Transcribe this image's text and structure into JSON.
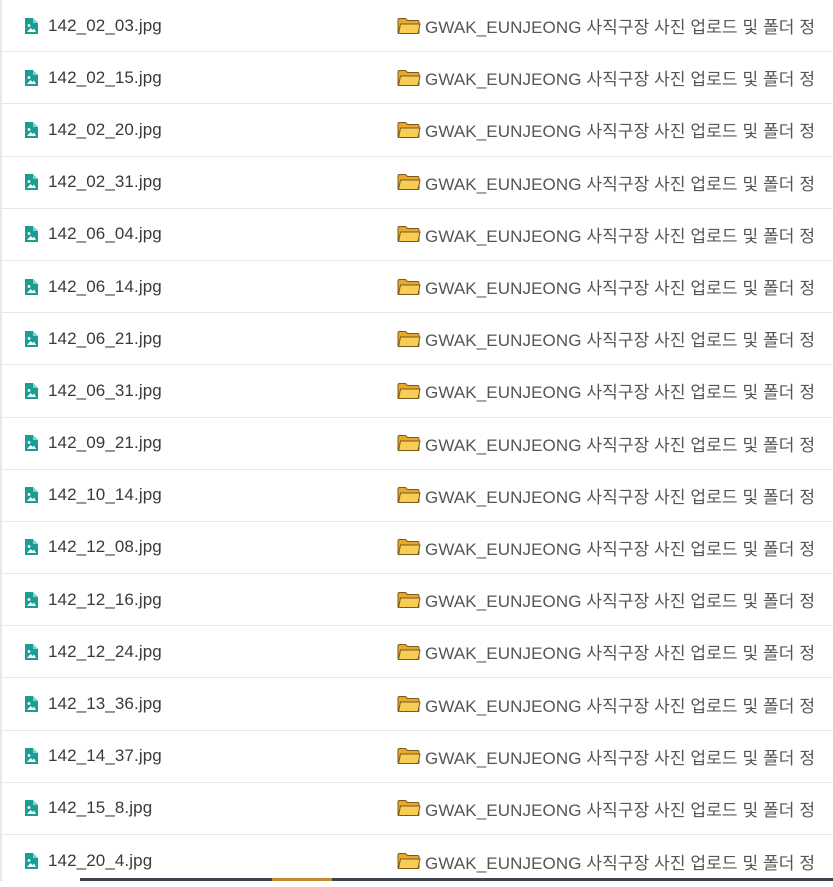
{
  "icons": {
    "file": "image-file-icon",
    "folder": "folder-icon",
    "file_color": "#1a9e94",
    "folder_color": "#f5c242"
  },
  "rows": [
    {
      "file": "142_02_03.jpg",
      "folder": "GWAK_EUNJEONG 사직구장 사진 업로드 및 폴더 정"
    },
    {
      "file": "142_02_15.jpg",
      "folder": "GWAK_EUNJEONG 사직구장 사진 업로드 및 폴더 정"
    },
    {
      "file": "142_02_20.jpg",
      "folder": "GWAK_EUNJEONG 사직구장 사진 업로드 및 폴더 정"
    },
    {
      "file": "142_02_31.jpg",
      "folder": "GWAK_EUNJEONG 사직구장 사진 업로드 및 폴더 정"
    },
    {
      "file": "142_06_04.jpg",
      "folder": "GWAK_EUNJEONG 사직구장 사진 업로드 및 폴더 정"
    },
    {
      "file": "142_06_14.jpg",
      "folder": "GWAK_EUNJEONG 사직구장 사진 업로드 및 폴더 정"
    },
    {
      "file": "142_06_21.jpg",
      "folder": "GWAK_EUNJEONG 사직구장 사진 업로드 및 폴더 정"
    },
    {
      "file": "142_06_31.jpg",
      "folder": "GWAK_EUNJEONG 사직구장 사진 업로드 및 폴더 정"
    },
    {
      "file": "142_09_21.jpg",
      "folder": "GWAK_EUNJEONG 사직구장 사진 업로드 및 폴더 정"
    },
    {
      "file": "142_10_14.jpg",
      "folder": "GWAK_EUNJEONG 사직구장 사진 업로드 및 폴더 정"
    },
    {
      "file": "142_12_08.jpg",
      "folder": "GWAK_EUNJEONG 사직구장 사진 업로드 및 폴더 정"
    },
    {
      "file": "142_12_16.jpg",
      "folder": "GWAK_EUNJEONG 사직구장 사진 업로드 및 폴더 정"
    },
    {
      "file": "142_12_24.jpg",
      "folder": "GWAK_EUNJEONG 사직구장 사진 업로드 및 폴더 정"
    },
    {
      "file": "142_13_36.jpg",
      "folder": "GWAK_EUNJEONG 사직구장 사진 업로드 및 폴더 정"
    },
    {
      "file": "142_14_37.jpg",
      "folder": "GWAK_EUNJEONG 사직구장 사진 업로드 및 폴더 정"
    },
    {
      "file": "142_15_8.jpg",
      "folder": "GWAK_EUNJEONG 사직구장 사진 업로드 및 폴더 정"
    },
    {
      "file": "142_20_4.jpg",
      "folder": "GWAK_EUNJEONG 사직구장 사진 업로드 및 폴더 정"
    }
  ]
}
